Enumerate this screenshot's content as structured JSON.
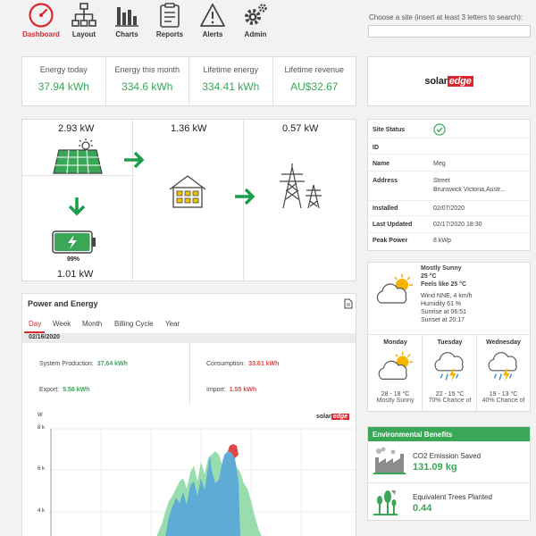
{
  "nav": {
    "items": [
      {
        "label": "Dashboard",
        "icon": "gauge-icon",
        "active": true
      },
      {
        "label": "Layout",
        "icon": "hierarchy-icon"
      },
      {
        "label": "Charts",
        "icon": "bar-chart-icon"
      },
      {
        "label": "Reports",
        "icon": "clipboard-icon"
      },
      {
        "label": "Alerts",
        "icon": "warning-icon"
      },
      {
        "label": "Admin",
        "icon": "gear-icon"
      }
    ]
  },
  "site_search": {
    "label": "Choose a site (insert at least 3 letters to search):",
    "value": ""
  },
  "summary": [
    {
      "title": "Energy today",
      "value": "37.94 kWh"
    },
    {
      "title": "Energy this month",
      "value": "334.6 kWh"
    },
    {
      "title": "Lifetime energy",
      "value": "334.41 kWh"
    },
    {
      "title": "Lifetime revenue",
      "value": "AU$32.67"
    }
  ],
  "logo": {
    "solar": "solar",
    "edge": "edge"
  },
  "flow": {
    "pv_power": "2.93 kW",
    "home_power": "1.36 kW",
    "grid_power": "0.57 kW",
    "battery_percent": "99%",
    "battery_power": "1.01 kW",
    "battery_level": 0.99
  },
  "site_status": {
    "rows": [
      {
        "key": "Site Status",
        "value": ""
      },
      {
        "key": "ID",
        "value": ""
      },
      {
        "key": "Name",
        "value": "Meg"
      },
      {
        "key": "Address",
        "value": "Street",
        "value2": "Brunswick Victoria,Austr..."
      },
      {
        "key": "Installed",
        "value": "02/07/2020"
      },
      {
        "key": "Last Updated",
        "value": "02/17/2020 18:30"
      },
      {
        "key": "Peak Power",
        "value": "8 kWp"
      }
    ]
  },
  "weather": {
    "now": {
      "condition": "Mostly Sunny",
      "temp": "25 °C",
      "feels_like": "Feels like 25 °C",
      "wind": "Wind NNE, 4 km/h",
      "humidity": "Humidity 61 %",
      "sunrise": "Sunrise at 06:51",
      "sunset": "Sunset at 20:17"
    },
    "days": [
      {
        "name": "Monday",
        "temps": "28 - 18 °C",
        "summary": "Mostly Sunny",
        "icon": "sun-cloud-icon"
      },
      {
        "name": "Tuesday",
        "temps": "22 - 15 °C",
        "summary": "70% Chance of",
        "icon": "storm-icon"
      },
      {
        "name": "Wednesday",
        "temps": "19 - 13 °C",
        "summary": "40% Chance of",
        "icon": "storm-icon"
      }
    ]
  },
  "env": {
    "header": "Environmental Benefits",
    "co2_title": "CO2 Emission Saved",
    "co2_value": "131.09 kg",
    "trees_title": "Equivalent Trees Planted",
    "trees_value": "0.44"
  },
  "power_energy": {
    "title": "Power and Energy",
    "tabs": [
      "Day",
      "Week",
      "Month",
      "Billing Cycle",
      "Year"
    ],
    "active_tab": "Day",
    "date": "02/16/2020",
    "production_label": "System Production:",
    "production_value": "37.64 kWh",
    "consumption_label": "Consumption:",
    "consumption_value": "33.61 kWh",
    "export_label": "Export:",
    "export_value": "5.58 kWh",
    "import_label": "Import:",
    "import_value": "1.55 kWh",
    "y_unit": "W",
    "y_ticks": [
      "8 k",
      "6 k",
      "4 k"
    ]
  },
  "colors": {
    "accent_red": "#d9272e",
    "green": "#3aa757",
    "consumption_red": "#e04848"
  }
}
